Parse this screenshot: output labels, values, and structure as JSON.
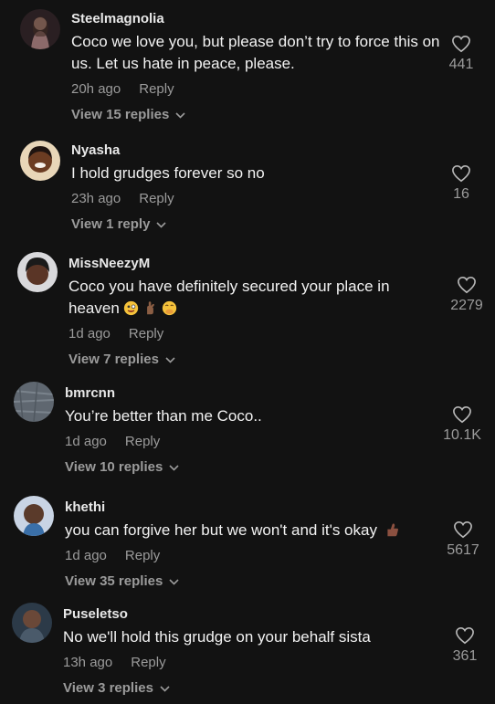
{
  "comments": [
    {
      "username": "Steelmagnolia",
      "text": "Coco we love you, but please don’t try to force this on us. Let us hate in peace, please.",
      "time": "20h ago",
      "reply_label": "Reply",
      "view_replies": "View 15 replies",
      "likes": "441"
    },
    {
      "username": "Nyasha",
      "text": "I hold grudges forever so no",
      "time": "23h ago",
      "reply_label": "Reply",
      "view_replies": "View 1 reply",
      "likes": "16"
    },
    {
      "username": "MissNeezyM",
      "text": "Coco you have definitely secured your place in heaven",
      "time": "1d ago",
      "reply_label": "Reply",
      "view_replies": "View 7 replies",
      "likes": "2279"
    },
    {
      "username": "bmrcnn",
      "text": "You’re better than me Coco..",
      "time": "1d ago",
      "reply_label": "Reply",
      "view_replies": "View 10 replies",
      "likes": "10.1K"
    },
    {
      "username": "khethi",
      "text": "you can forgive her but we won't and it's okay",
      "time": "1d ago",
      "reply_label": "Reply",
      "view_replies": "View 35 replies",
      "likes": "5617"
    },
    {
      "username": "Puseletso",
      "text": "No we'll hold this grudge on your behalf sista",
      "time": "13h ago",
      "reply_label": "Reply",
      "view_replies": "View 3 replies",
      "likes": "361"
    }
  ],
  "icons": {
    "like": "heart-outline-icon",
    "expand": "chevron-down-icon"
  },
  "colors": {
    "background": "#121212",
    "meta_text": "#9b9b9b"
  }
}
